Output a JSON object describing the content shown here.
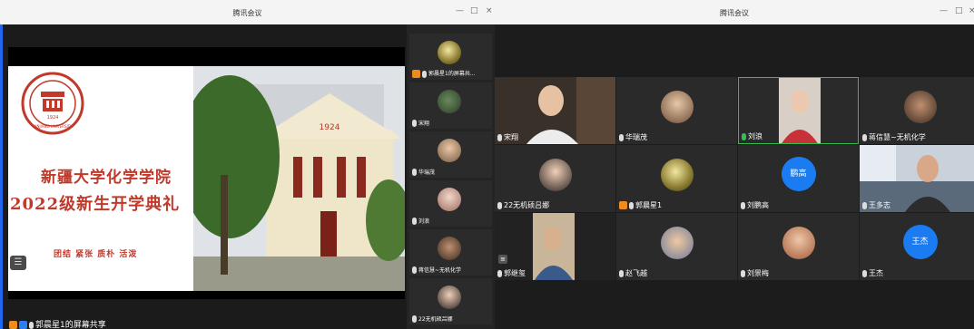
{
  "window1": {
    "title": "腾讯会议",
    "controls": [
      "—",
      "□",
      "×"
    ],
    "banner": {
      "logo_text": "XINJIANG UNIVERSITY",
      "logo_year": "1924",
      "title_line1": "新疆大学化学学院",
      "title_line2": "2022级新生开学典礼",
      "slogan": "团结 紧张 质朴 活泼",
      "photo_year": "1924"
    },
    "share_label": "郭晨星1的屏幕共享",
    "strip": [
      {
        "name": "郭晨星1的屏幕共..."
      },
      {
        "name": "宋翔"
      },
      {
        "name": "华瑞茂"
      },
      {
        "name": "刘浪"
      },
      {
        "name": "蒋信慧~无机化学"
      },
      {
        "name": "22无机硕吕娜"
      }
    ]
  },
  "window2": {
    "title": "腾讯会议",
    "controls": [
      "—",
      "□",
      "×"
    ],
    "tiles": [
      {
        "name": "宋翔",
        "kind": "video"
      },
      {
        "name": "华瑞茂",
        "kind": "photo"
      },
      {
        "name": "刘浪",
        "kind": "video"
      },
      {
        "name": "蒋信慧~无机化学",
        "kind": "photo"
      },
      {
        "name": "22无机硕吕娜",
        "kind": "photo"
      },
      {
        "name": "郭晨星1",
        "kind": "photo"
      },
      {
        "name": "刘鹏高",
        "kind": "initials",
        "initials": "鹏高"
      },
      {
        "name": "王多志",
        "kind": "video"
      },
      {
        "name": "郭继玺",
        "kind": "video"
      },
      {
        "name": "赵飞越",
        "kind": "photo"
      },
      {
        "name": "刘景梅",
        "kind": "photo"
      },
      {
        "name": "王杰",
        "kind": "initials",
        "initials": "王杰"
      }
    ]
  },
  "colors": {
    "accent_blue": "#1b7cf2",
    "banner_red": "#c0392b",
    "host_orange": "#f08c1e",
    "active_green": "#2fc052"
  }
}
